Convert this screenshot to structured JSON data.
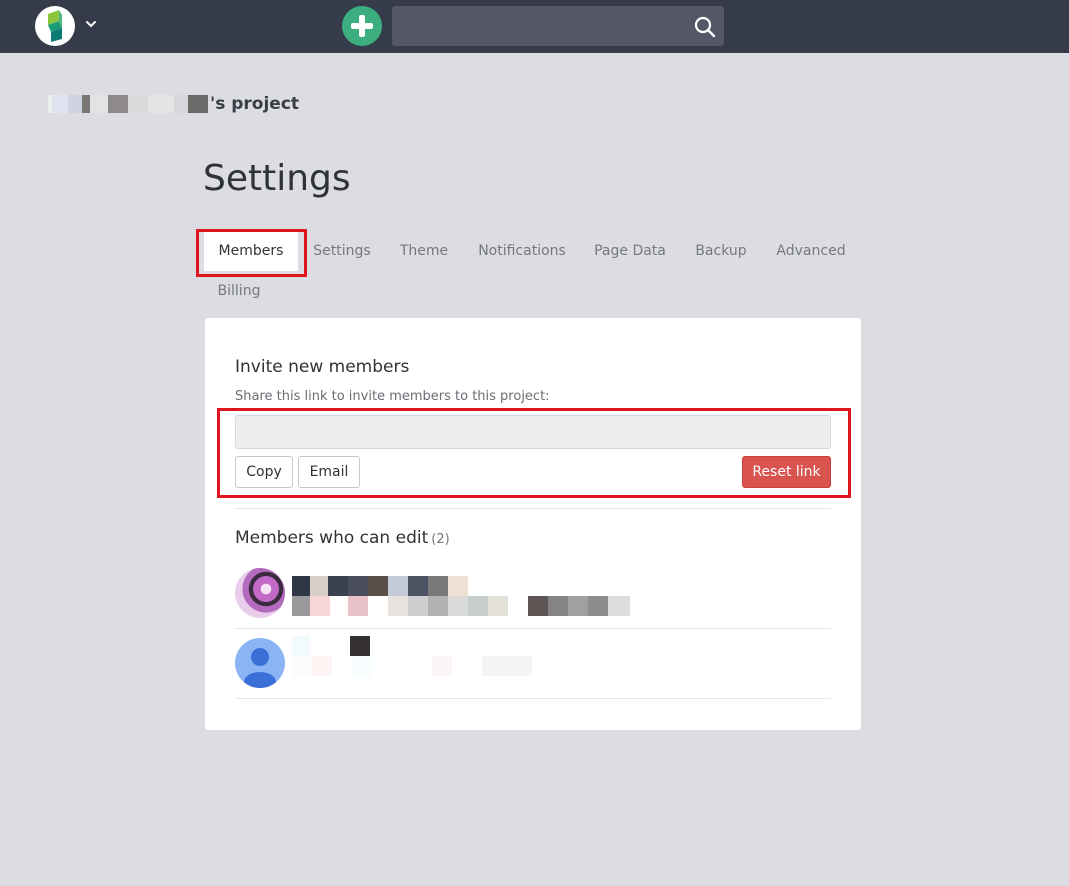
{
  "header": {
    "search": {
      "value": "",
      "placeholder": ""
    }
  },
  "project": {
    "name_suffix": "'s project"
  },
  "page": {
    "title": "Settings"
  },
  "tabs": [
    {
      "label": "Members",
      "active": true
    },
    {
      "label": "Settings"
    },
    {
      "label": "Theme"
    },
    {
      "label": "Notifications"
    },
    {
      "label": "Page Data"
    },
    {
      "label": "Backup"
    },
    {
      "label": "Advanced"
    },
    {
      "label": "Billing"
    }
  ],
  "invite": {
    "title": "Invite new members",
    "help": "Share this link to invite members to this project:",
    "link_value": "",
    "copy_label": "Copy",
    "email_label": "Email",
    "reset_label": "Reset link"
  },
  "members": {
    "title": "Members who can edit",
    "count": "(2)"
  },
  "colors": {
    "topbar": "#363b4a",
    "accent_green": "#3dae7f",
    "danger": "#d9534f",
    "highlight": "#e0161f",
    "background": "#dcdde2"
  },
  "icons": {
    "logo": "app-logo-icon",
    "caret": "chevron-down-icon",
    "add": "plus-icon",
    "search": "search-icon"
  }
}
